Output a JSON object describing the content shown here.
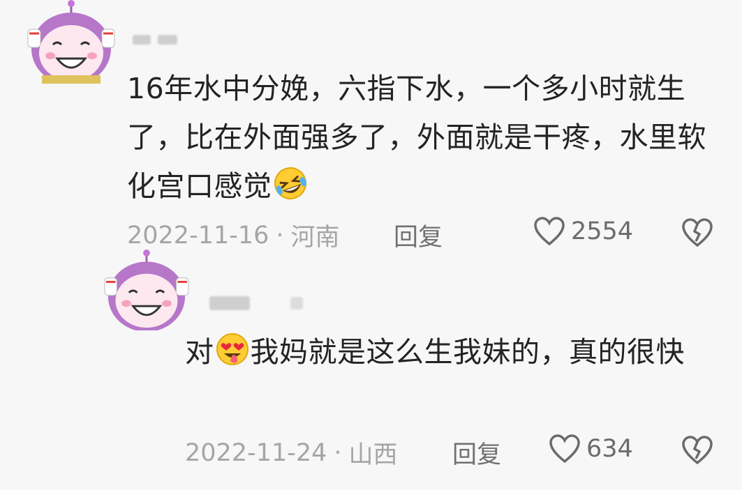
{
  "comments": [
    {
      "text_before_emoji": "16年水中分娩，六指下水，一个多小时就生了，比在外面强多了，外面就是干疼，水里软化宫口感觉",
      "text_after_emoji": "",
      "emoji": "rofl-emoji",
      "date": "2022-11-16",
      "sep": "·",
      "location": "河南",
      "reply_label": "回复",
      "likes": "2554"
    },
    {
      "text_before_emoji": "对",
      "text_after_emoji": "我妈就是这么生我妹的，真的很快",
      "emoji": "heart-eyes-tongue-emoji",
      "date": "2022-11-24",
      "sep": "·",
      "location": "山西",
      "reply_label": "回复",
      "likes": "634"
    }
  ],
  "icons": {
    "like": "heart-outline-icon",
    "dislike": "broken-heart-icon"
  },
  "colors": {
    "avatar_purple": "#b677c9",
    "avatar_face": "#fde8f0",
    "meta_gray": "#a5a5a5"
  }
}
